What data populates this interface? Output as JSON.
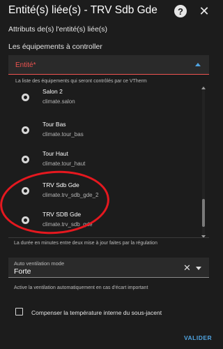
{
  "dialog": {
    "title": "Entité(s) liée(s) - TRV Sdb Gde",
    "help_icon": "?",
    "close_icon": "✕"
  },
  "section": {
    "subtitle": "Attributs de(s) l'entité(s) liée(s)",
    "equipments_label": "Les équipements à controller"
  },
  "entity_field": {
    "label": "Entité*",
    "helper": "La liste des équipements qui seront contrôlés par ce VTherm"
  },
  "entity_list": [
    {
      "name": "Salon 2",
      "entity_id": "climate.salon"
    },
    {
      "name": "Tour Bas",
      "entity_id": "climate.tour_bas"
    },
    {
      "name": "Tour Haut",
      "entity_id": "climate.tour_haut"
    },
    {
      "name": "TRV Sdb Gde",
      "entity_id": "climate.trv_sdb_gde_2"
    },
    {
      "name": "TRV SDB Gde",
      "entity_id": "climate.trv_sdb_gde"
    }
  ],
  "update_helper": "La durée en minutes entre deux mise à jour faites par la régulation",
  "auto_ventilation": {
    "label": "Auto ventilation mode",
    "value": "Forte",
    "helper": "Active la ventilation automatiquement en cas d'écart important"
  },
  "compensation": {
    "label": "Compenser la température interne du sous-jacent",
    "checked": false
  },
  "submit_label": "VALIDER",
  "colors": {
    "background": "#1c1c1c",
    "error": "#ef5350",
    "accent": "#4fa3e0",
    "annotation": "#e5181f"
  }
}
